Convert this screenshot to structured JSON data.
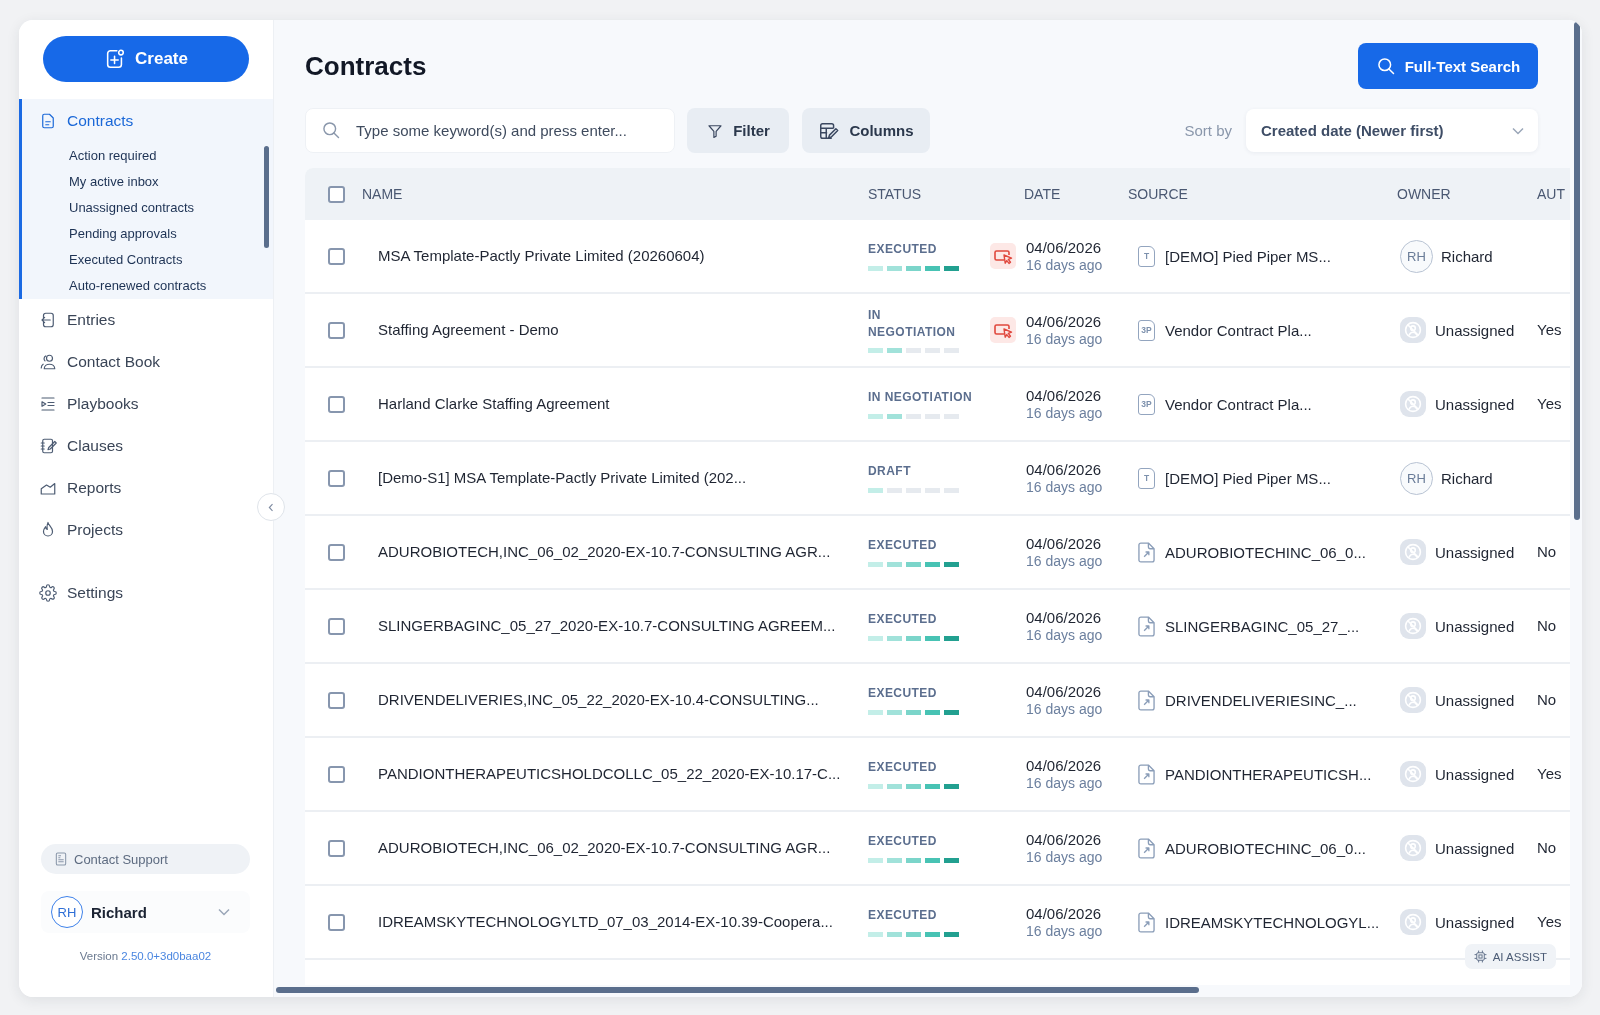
{
  "sidebar": {
    "create_button": "Create",
    "nav": [
      {
        "label": "Contracts",
        "selected": true,
        "children": [
          {
            "label": "Action required",
            "selected": false
          },
          {
            "label": "My active inbox",
            "selected": false
          },
          {
            "label": "Unassigned contracts",
            "selected": false
          },
          {
            "label": "Pending approvals",
            "selected": false
          },
          {
            "label": "Executed Contracts",
            "selected": false
          },
          {
            "label": "Auto-renewed contracts",
            "selected": false
          }
        ]
      },
      {
        "label": "Entries",
        "selected": false
      },
      {
        "label": "Contact Book",
        "selected": false
      },
      {
        "label": "Playbooks",
        "selected": false
      },
      {
        "label": "Clauses",
        "selected": false
      },
      {
        "label": "Reports",
        "selected": false
      },
      {
        "label": "Projects",
        "selected": false
      }
    ],
    "settings": {
      "label": "Settings",
      "selected": false
    },
    "contact_support_button": "Contact Support",
    "user": {
      "initials": "RH",
      "name": "Richard"
    },
    "version": {
      "label": "Version",
      "number": "2.50.0+3d0baa02"
    }
  },
  "header": {
    "title": "Contracts",
    "full_text_search_button": "Full-Text Search"
  },
  "toolbar": {
    "search": {
      "placeholder": "Type some keyword(s) and press enter..."
    },
    "filter_button": "Filter",
    "columns_button": "Columns",
    "sort": {
      "label": "Sort by",
      "value": "Created date (Newer first)"
    }
  },
  "table": {
    "select_all": {
      "checked": false
    },
    "columns": [
      "NAME",
      "STATUS",
      "DATE",
      "SOURCE",
      "OWNER",
      "AUT"
    ],
    "rows": [
      {
        "checked": false,
        "name": "MSA Template-Pactly Private Limited (20260604)",
        "status": {
          "label": "EXECUTED",
          "level": 1
        },
        "action_icon": true,
        "date": "04/06/2026",
        "age": "16 days ago",
        "source": {
          "kind": "template",
          "icon_label": "T",
          "label": "[DEMO] Pied Piper MS..."
        },
        "owner": {
          "kind": "user",
          "initials": "RH",
          "name": "Richard"
        }
      },
      {
        "checked": false,
        "name": "Staffing Agreement - Demo",
        "status": {
          "label": "IN NEGOTIATION",
          "level": 0.4
        },
        "action_icon": true,
        "date": "04/06/2026",
        "age": "16 days ago",
        "source": {
          "kind": "third_party",
          "icon_label": "3P",
          "label": "Vendor Contract Pla..."
        },
        "owner": {
          "kind": "unassigned",
          "name": "Unassigned"
        },
        "column_7": "Yes"
      },
      {
        "checked": false,
        "name": "Harland Clarke Staffing Agreement",
        "status": {
          "label": "IN NEGOTIATION",
          "level": 0.4
        },
        "action_icon": false,
        "date": "04/06/2026",
        "age": "16 days ago",
        "source": {
          "kind": "third_party",
          "icon_label": "3P",
          "label": "Vendor Contract Pla..."
        },
        "owner": {
          "kind": "unassigned",
          "name": "Unassigned"
        },
        "column_7": "Yes"
      },
      {
        "checked": false,
        "name": "[Demo-S1] MSA Template-Pactly Private Limited (202...",
        "status": {
          "label": "DRAFT",
          "level": 0.2
        },
        "action_icon": false,
        "date": "04/06/2026",
        "age": "16 days ago",
        "source": {
          "kind": "template",
          "icon_label": "T",
          "label": "[DEMO] Pied Piper MS..."
        },
        "owner": {
          "kind": "user",
          "initials": "RH",
          "name": "Richard"
        }
      },
      {
        "checked": false,
        "name": "ADUROBIOTECH,INC_06_02_2020-EX-10.7-CONSULTING AGR...",
        "status": {
          "label": "EXECUTED",
          "level": 1
        },
        "action_icon": false,
        "date": "04/06/2026",
        "age": "16 days ago",
        "source": {
          "kind": "upload",
          "label": "ADUROBIOTECHINC_06_0..."
        },
        "owner": {
          "kind": "unassigned",
          "name": "Unassigned"
        },
        "column_7": "No"
      },
      {
        "checked": false,
        "name": "SLINGERBAGINC_05_27_2020-EX-10.7-CONSULTING AGREEM...",
        "status": {
          "label": "EXECUTED",
          "level": 1
        },
        "action_icon": false,
        "date": "04/06/2026",
        "age": "16 days ago",
        "source": {
          "kind": "upload",
          "label": "SLINGERBAGINC_05_27_..."
        },
        "owner": {
          "kind": "unassigned",
          "name": "Unassigned"
        },
        "column_7": "No"
      },
      {
        "checked": false,
        "name": "DRIVENDELIVERIES,INC_05_22_2020-EX-10.4-CONSULTING...",
        "status": {
          "label": "EXECUTED",
          "level": 1
        },
        "action_icon": false,
        "date": "04/06/2026",
        "age": "16 days ago",
        "source": {
          "kind": "upload",
          "label": "DRIVENDELIVERIESINC_..."
        },
        "owner": {
          "kind": "unassigned",
          "name": "Unassigned"
        },
        "column_7": "No"
      },
      {
        "checked": false,
        "name": "PANDIONTHERAPEUTICSHOLDCOLLC_05_22_2020-EX-10.17-C...",
        "status": {
          "label": "EXECUTED",
          "level": 1
        },
        "action_icon": false,
        "date": "04/06/2026",
        "age": "16 days ago",
        "source": {
          "kind": "upload",
          "label": "PANDIONTHERAPEUTICSH..."
        },
        "owner": {
          "kind": "unassigned",
          "name": "Unassigned"
        },
        "column_7": "Yes"
      },
      {
        "checked": false,
        "name": "ADUROBIOTECH,INC_06_02_2020-EX-10.7-CONSULTING AGR...",
        "status": {
          "label": "EXECUTED",
          "level": 1
        },
        "action_icon": false,
        "date": "04/06/2026",
        "age": "16 days ago",
        "source": {
          "kind": "upload",
          "label": "ADUROBIOTECHINC_06_0..."
        },
        "owner": {
          "kind": "unassigned",
          "name": "Unassigned"
        },
        "column_7": "No"
      },
      {
        "checked": false,
        "name": "IDREAMSKYTECHNOLOGYLTD_07_03_2014-EX-10.39-Coopera...",
        "status": {
          "label": "EXECUTED",
          "level": 1
        },
        "action_icon": false,
        "date": "04/06/2026",
        "age": "16 days ago",
        "source": {
          "kind": "upload",
          "label": "IDREAMSKYTECHNOLOGYL..."
        },
        "owner": {
          "kind": "unassigned",
          "name": "Unassigned"
        },
        "column_7": "Yes"
      }
    ]
  },
  "ai_assist_button": "AI ASSIST"
}
